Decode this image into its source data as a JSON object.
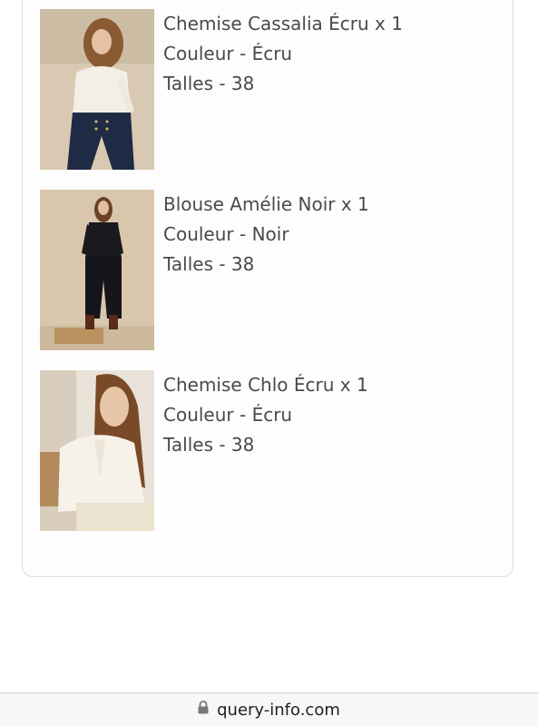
{
  "order_items": [
    {
      "name": "Chemise Cassalia Écru x 1",
      "color": "Couleur - Écru",
      "size": "Talles - 38",
      "image_icon": "product-photo-cream-blouse-navy-trousers"
    },
    {
      "name": "Blouse Amélie Noir x 1",
      "color": "Couleur - Noir",
      "size": "Talles - 38",
      "image_icon": "product-photo-black-blouse-black-trousers"
    },
    {
      "name": "Chemise Chlo Écru x 1",
      "color": "Couleur - Écru",
      "size": "Talles - 38",
      "image_icon": "product-photo-white-ruffle-shirt"
    }
  ],
  "browser": {
    "url": "query-info.com",
    "lock_icon": "lock-icon"
  }
}
